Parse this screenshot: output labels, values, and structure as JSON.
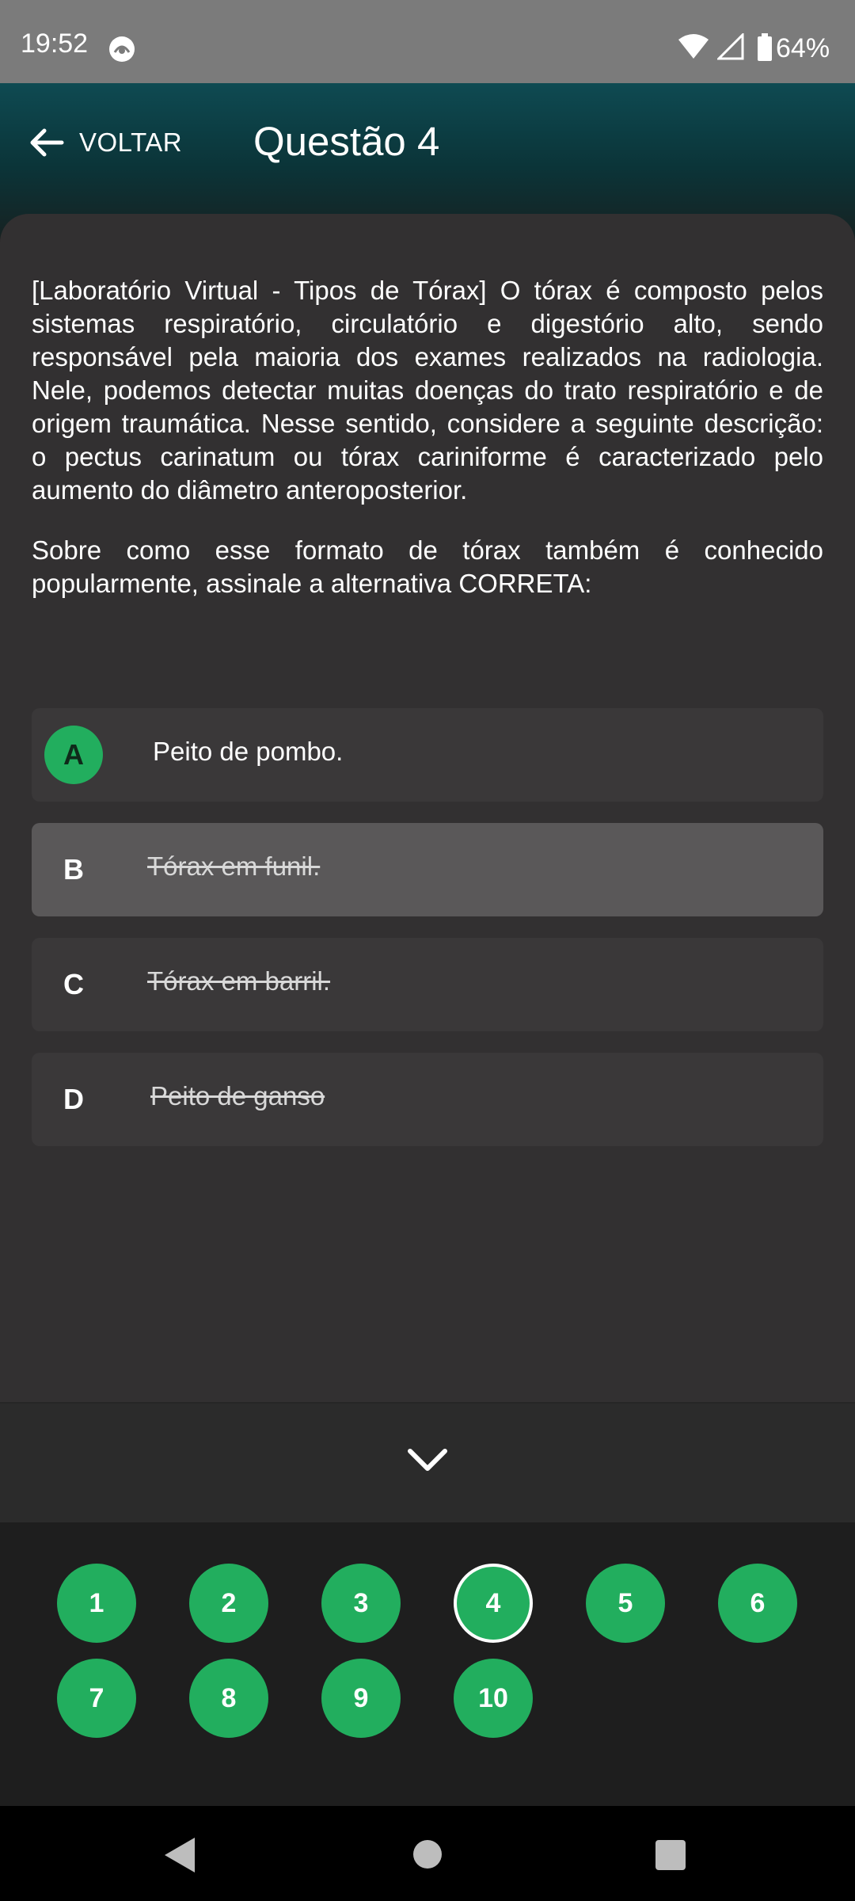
{
  "status_bar": {
    "time": "19:52",
    "battery": "64%",
    "icons": [
      "app-notification-icon",
      "wifi-icon",
      "signal-icon",
      "battery-icon"
    ]
  },
  "header": {
    "back_label": "VOLTAR",
    "title": "Questão 4"
  },
  "question": {
    "text": "[Laboratório Virtual - Tipos de Tórax] O tórax é composto pelos sistemas respiratório, circulatório e digestório alto, sendo responsável pela maioria dos exames realizados na radiologia. Nele, podemos detectar muitas doenças do trato respiratório e de origem traumática. Nesse sentido, considere a seguinte descrição: o pectus carinatum ou tórax cariniforme é caracterizado pelo aumento do diâmetro anteroposterior.",
    "prompt": "Sobre como esse formato de tórax também é conhecido popularmente, assinale a alternativa CORRETA:"
  },
  "options": [
    {
      "letter": "A",
      "text": "Peito de pombo.",
      "state": "correct"
    },
    {
      "letter": "B",
      "text": "Tórax em funil.",
      "state": "struck"
    },
    {
      "letter": "C",
      "text": "Tórax em barril.",
      "state": "struck"
    },
    {
      "letter": "D",
      "text": "Peito de ganso",
      "state": "struck"
    }
  ],
  "navigator": {
    "current": "4",
    "numbers": [
      "1",
      "2",
      "3",
      "4",
      "5",
      "6",
      "7",
      "8",
      "9",
      "10"
    ]
  },
  "colors": {
    "accent_green": "#22ae5e",
    "card_bg": "#323031",
    "header_teal": "#0b3438"
  }
}
